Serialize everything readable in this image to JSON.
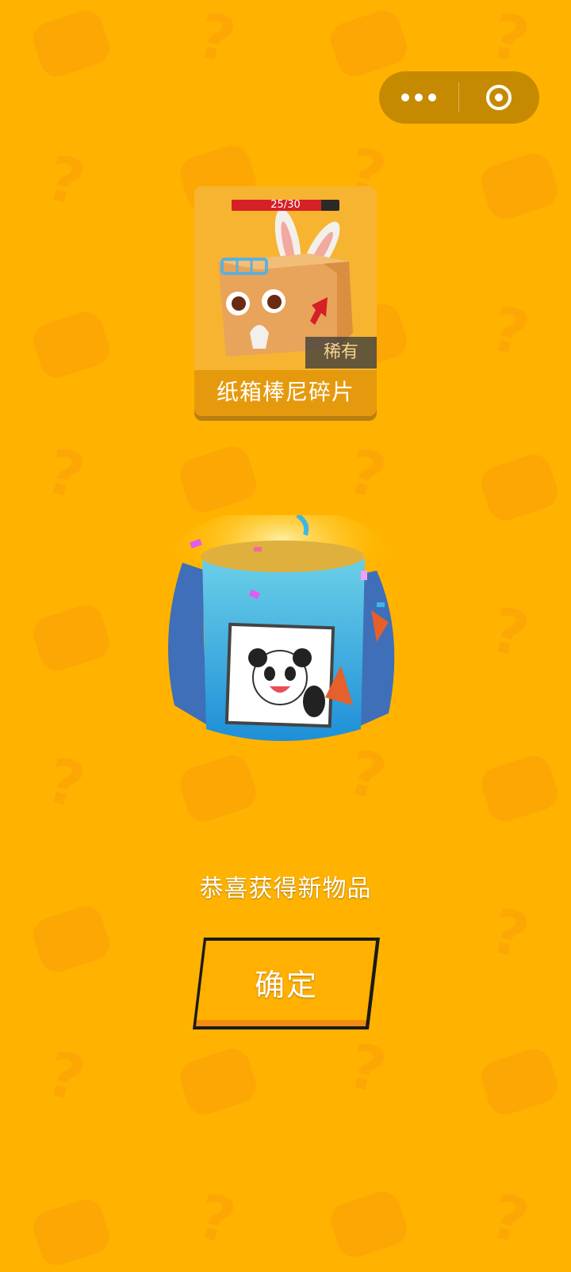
{
  "capsule": {
    "more_icon": "more-dots-icon",
    "close_icon": "close-circle-icon"
  },
  "item": {
    "progress_text": "25/30",
    "progress_fraction": 0.8333,
    "rarity": "稀有",
    "name": "纸箱棒尼碎片"
  },
  "message": "恭喜获得新物品",
  "confirm_label": "确定",
  "colors": {
    "background": "#FFB300",
    "button": "#FFB000",
    "rarity_text": "#F4D38E",
    "progress_fill": "#D62027"
  }
}
